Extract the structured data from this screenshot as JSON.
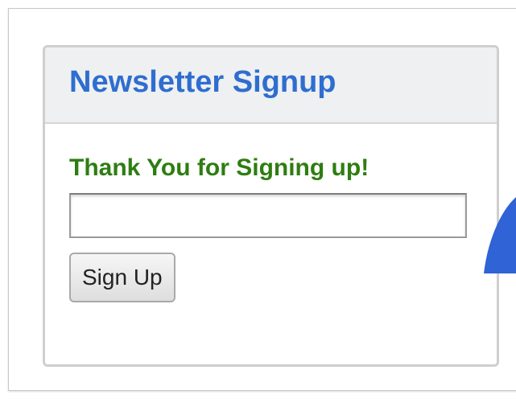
{
  "widget": {
    "title": "Newsletter Signup",
    "thank_you_message": "Thank You for Signing up!",
    "email_input": {
      "value": "",
      "placeholder": ""
    },
    "submit_label": "Sign Up"
  },
  "colors": {
    "title": "#2f6ecf",
    "thank_you": "#2e7d12",
    "header_bg": "#eef0f2",
    "cursor_shape": "#2f63d6"
  },
  "icons": {
    "overlay_shape": "blue-pointer-shape"
  }
}
